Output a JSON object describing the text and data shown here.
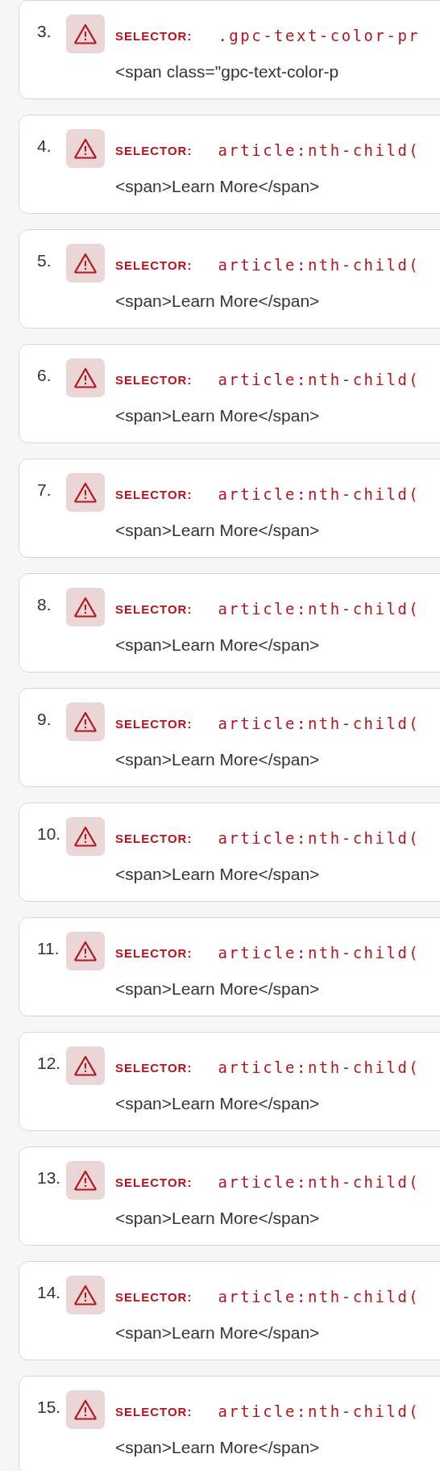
{
  "issues": [
    {
      "number": "3.",
      "label": "SELECTOR:",
      "selector": ".gpc-text-color-pr",
      "snippet": "<span class=\"gpc-text-color-p"
    },
    {
      "number": "4.",
      "label": "SELECTOR:",
      "selector": "article:nth-child(",
      "snippet": "<span>Learn More</span>"
    },
    {
      "number": "5.",
      "label": "SELECTOR:",
      "selector": "article:nth-child(",
      "snippet": "<span>Learn More</span>"
    },
    {
      "number": "6.",
      "label": "SELECTOR:",
      "selector": "article:nth-child(",
      "snippet": "<span>Learn More</span>"
    },
    {
      "number": "7.",
      "label": "SELECTOR:",
      "selector": "article:nth-child(",
      "snippet": "<span>Learn More</span>"
    },
    {
      "number": "8.",
      "label": "SELECTOR:",
      "selector": "article:nth-child(",
      "snippet": "<span>Learn More</span>"
    },
    {
      "number": "9.",
      "label": "SELECTOR:",
      "selector": "article:nth-child(",
      "snippet": "<span>Learn More</span>"
    },
    {
      "number": "10.",
      "label": "SELECTOR:",
      "selector": "article:nth-child(",
      "snippet": "<span>Learn More</span>"
    },
    {
      "number": "11.",
      "label": "SELECTOR:",
      "selector": "article:nth-child(",
      "snippet": "<span>Learn More</span>"
    },
    {
      "number": "12.",
      "label": "SELECTOR:",
      "selector": "article:nth-child(",
      "snippet": "<span>Learn More</span>"
    },
    {
      "number": "13.",
      "label": "SELECTOR:",
      "selector": "article:nth-child(",
      "snippet": "<span>Learn More</span>"
    },
    {
      "number": "14.",
      "label": "SELECTOR:",
      "selector": "article:nth-child(",
      "snippet": "<span>Learn More</span>"
    },
    {
      "number": "15.",
      "label": "SELECTOR:",
      "selector": "article:nth-child(",
      "snippet": "<span>Learn More</span>"
    }
  ]
}
